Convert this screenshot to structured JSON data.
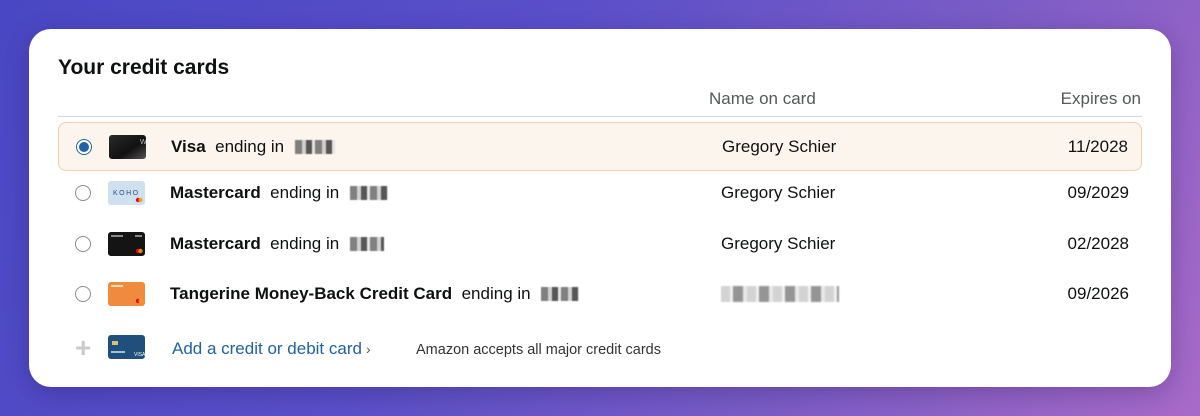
{
  "title": "Your credit cards",
  "columns": {
    "name": "Name on card",
    "expires": "Expires on"
  },
  "cards": [
    {
      "brand": "Visa",
      "ending_text": "ending in",
      "name": "Gregory Schier",
      "expires": "11/2028",
      "selected": true,
      "thumb_icon": "black-card-icon"
    },
    {
      "brand": "Mastercard",
      "ending_text": "ending in",
      "name": "Gregory Schier",
      "expires": "09/2029",
      "selected": false,
      "thumb_icon": "koho-card-icon",
      "thumb_text": "KOHO"
    },
    {
      "brand": "Mastercard",
      "ending_text": "ending in",
      "name": "Gregory Schier",
      "expires": "02/2028",
      "selected": false,
      "thumb_icon": "dark-mastercard-icon"
    },
    {
      "brand": "Tangerine Money-Back Credit Card",
      "ending_text": "ending in",
      "name": "",
      "expires": "09/2026",
      "selected": false,
      "thumb_icon": "tangerine-card-icon"
    }
  ],
  "add": {
    "link_label": "Add a credit or debit card",
    "chevron": "›",
    "note": "Amazon accepts all major credit cards",
    "plus": "+"
  }
}
